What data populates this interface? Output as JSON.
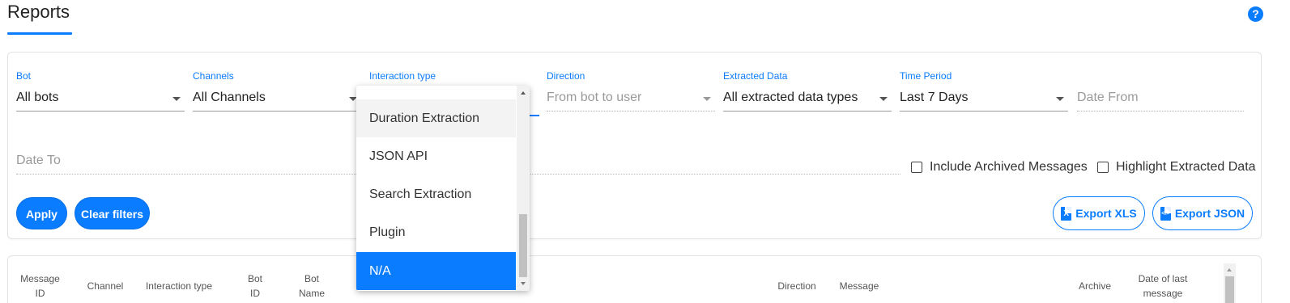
{
  "header": {
    "title": "Reports",
    "help_icon": "question-circle-icon",
    "help_glyph": "?"
  },
  "filters": {
    "bot": {
      "label": "Bot",
      "value": "All bots"
    },
    "channels": {
      "label": "Channels",
      "value": "All Channels"
    },
    "interaction_type": {
      "label": "Interaction type"
    },
    "direction": {
      "label": "Direction",
      "placeholder": "From bot to user"
    },
    "extracted_data": {
      "label": "Extracted Data",
      "value": "All extracted data types"
    },
    "time_period": {
      "label": "Time Period",
      "value": "Last 7 Days"
    },
    "date_from": {
      "placeholder": "Date From"
    },
    "date_to": {
      "placeholder": "Date To"
    },
    "include_archived": {
      "label": "Include Archived Messages",
      "checked": false
    },
    "highlight_extracted": {
      "label": "Highlight Extracted Data",
      "checked": false
    }
  },
  "actions": {
    "apply": "Apply",
    "clear_filters": "Clear filters",
    "export_xls": "Export XLS",
    "export_json": "Export JSON",
    "xls_glyph": "X",
    "json_glyph": "</>"
  },
  "dropdown": {
    "items": [
      {
        "label": "Duration Extraction",
        "state": "hover"
      },
      {
        "label": "JSON API",
        "state": "normal"
      },
      {
        "label": "Search Extraction",
        "state": "normal"
      },
      {
        "label": "Plugin",
        "state": "normal"
      },
      {
        "label": "N/A",
        "state": "selected"
      }
    ]
  },
  "table": {
    "columns": {
      "message_id": [
        "Message",
        "ID"
      ],
      "channel": "Channel",
      "interaction_type": "Interaction type",
      "bot_id": [
        "Bot",
        "ID"
      ],
      "bot_name": [
        "Bot",
        "Name"
      ],
      "direction": "Direction",
      "message": "Message",
      "archive": "Archive",
      "date_last_message": [
        "Date of last",
        "message"
      ]
    }
  },
  "colors": {
    "accent": "#0a7cff",
    "hover": "#f3f3f3"
  }
}
